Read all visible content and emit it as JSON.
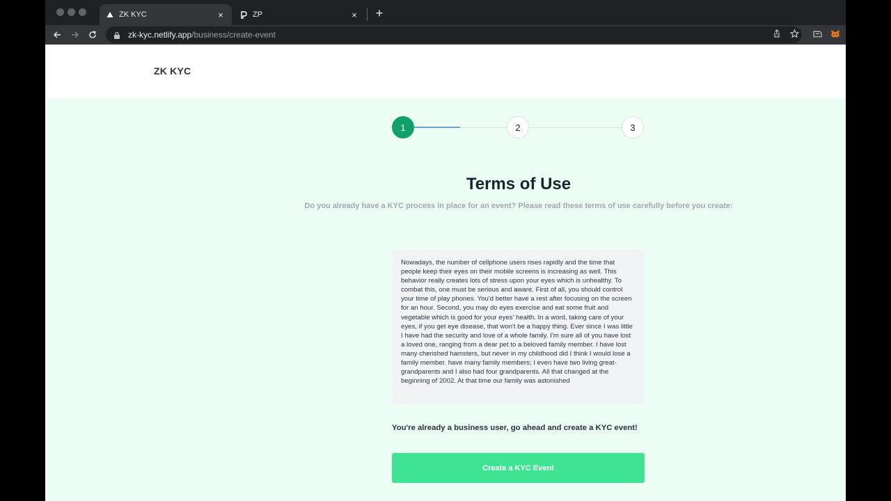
{
  "browser": {
    "tabs": [
      {
        "title": "ZK KYC",
        "active": true
      },
      {
        "title": "ZP",
        "active": false
      }
    ],
    "close_glyph": "×",
    "newtab_glyph": "+",
    "url_host": "zk-kyc.netlify.app",
    "url_path": "/business/create-event"
  },
  "site": {
    "brand": "ZK KYC"
  },
  "stepper": {
    "steps": [
      "1",
      "2",
      "3"
    ],
    "current_step": 1,
    "accent_color": "#12a06a"
  },
  "content": {
    "title": "Terms of Use",
    "subtitle": "Do you already have a KYC process in place for an event? Please read these terms of use carefully before you create:",
    "terms_text": "Nowadays, the number of cellphone users rises rapidly and the time that people keep their eyes on their mobile screens is increasing as well. This behavior really creates lots of stress upon your eyes which is unhealthy. To combat this, one must be serious and aware. First of all, you should control your time of play phones. You'd better have a rest after focusing on the screen for an hour. Second, you may do eyes exercise and eat some fruit and vegetable which is good for your eyes' health. In a word, taking care of your eyes, if you get eye disease, that won't be a happy thing. Ever since I was little I have had the security and love of a whole family. I'm sure all of you have lost a loved one, ranging from a dear pet to a beloved family member. I have lost many cherished hamsters, but never in my childhood did I think I would lose a family member. have many family members; I even have two living great-grandparents and I also had four grandparents. All that changed at the beginning of 2002. At that time our family was astonished",
    "notice": "You're already a business user, go ahead and create a KYC event!",
    "cta_label": "Create a KYC Event",
    "cta_color": "#3fe493"
  }
}
